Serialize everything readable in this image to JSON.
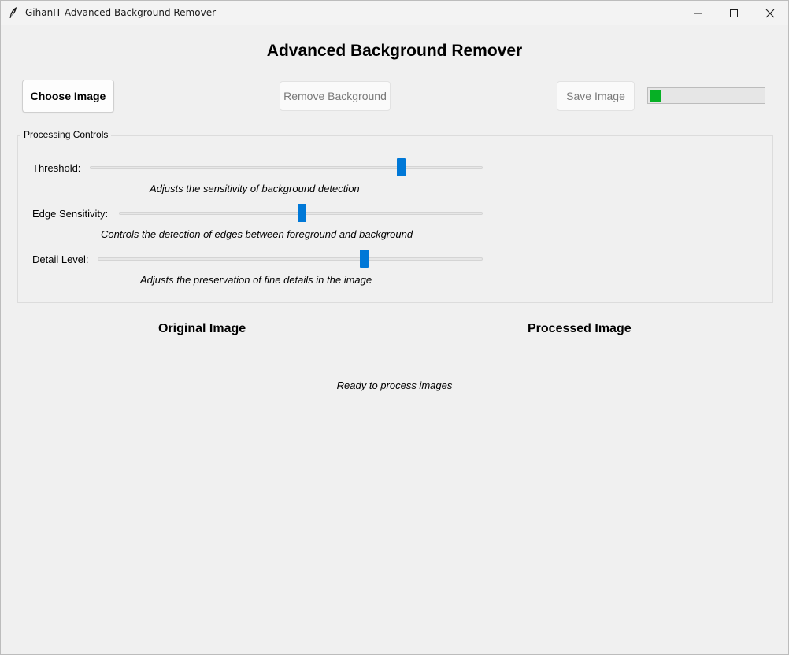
{
  "window": {
    "title": "GihanIT Advanced Background Remover",
    "icon": "feather-icon",
    "controls": [
      "minimize-icon",
      "maximize-icon",
      "close-icon"
    ]
  },
  "header": {
    "title": "Advanced Background Remover"
  },
  "toolbar": {
    "choose_label": "Choose Image",
    "remove_label": "Remove Background",
    "save_label": "Save Image",
    "remove_enabled": false,
    "save_enabled": false,
    "progress_percent": 10
  },
  "controls": {
    "group_label": "Processing Controls",
    "sliders": [
      {
        "label": "Threshold:",
        "description": "Adjusts the sensitivity of background detection",
        "value_fraction": 0.79
      },
      {
        "label": "Edge Sensitivity:",
        "description": "Controls the detection of edges between foreground and background",
        "value_fraction": 0.5
      },
      {
        "label": "Detail Level:",
        "description": "Adjusts the preservation of fine details in the image",
        "value_fraction": 0.69
      }
    ]
  },
  "images": {
    "original_title": "Original Image",
    "processed_title": "Processed Image"
  },
  "status": {
    "text": "Ready to process images"
  },
  "colors": {
    "accent": "#0078d7",
    "progress": "#06b025",
    "background": "#f0f0f0"
  }
}
